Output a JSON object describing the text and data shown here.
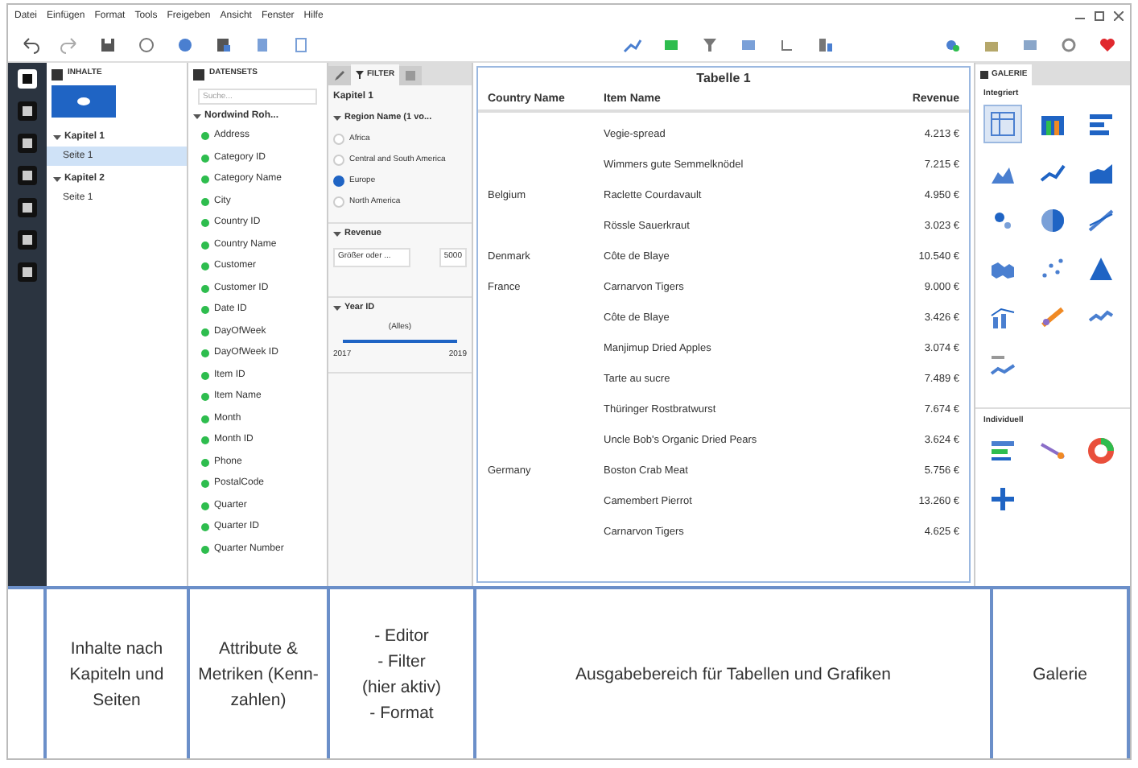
{
  "menu": [
    "Datei",
    "Einfügen",
    "Format",
    "Tools",
    "Freigeben",
    "Ansicht",
    "Fenster",
    "Hilfe"
  ],
  "contents": {
    "title": "INHALTE",
    "chapters": [
      {
        "label": "Kapitel 1",
        "expanded": true,
        "pages": [
          {
            "label": "Seite 1",
            "selected": true
          }
        ]
      },
      {
        "label": "Kapitel 2",
        "expanded": true,
        "pages": [
          {
            "label": "Seite 1",
            "selected": false
          }
        ]
      }
    ]
  },
  "datasets": {
    "title": "DATENSETS",
    "search": {
      "placeholder": "Suche..."
    },
    "dataset": "Nordwind Roh...",
    "items": [
      "Address",
      "Category ID",
      "Category Name",
      "City",
      "Country ID",
      "Country Name",
      "Customer",
      "Customer ID",
      "Date ID",
      "DayOfWeek",
      "DayOfWeek ID",
      "Item ID",
      "Item Name",
      "Month",
      "Month ID",
      "Phone",
      "PostalCode",
      "Quarter",
      "Quarter ID",
      "Quarter Number"
    ]
  },
  "filter": {
    "tab": "FILTER",
    "chapter": "Kapitel 1",
    "filters": [
      {
        "kind": "options",
        "title": "Region Name (1 vo...",
        "options": [
          {
            "label": "Africa",
            "selected": false
          },
          {
            "label": "Central and South America",
            "selected": false
          },
          {
            "label": "Europe",
            "selected": true
          },
          {
            "label": "North America",
            "selected": false
          }
        ]
      },
      {
        "kind": "metric",
        "title": "Revenue",
        "operator": "Größer oder ...",
        "value": "5000"
      },
      {
        "kind": "range",
        "title": "Year ID",
        "caption": "(Alles)",
        "level": 1,
        "min": "2017",
        "max": "2019"
      }
    ]
  },
  "table": {
    "title": "Tabelle 1",
    "columns": [
      "Country Name",
      "Item Name",
      "Revenue"
    ],
    "rows": [
      [
        "",
        "Vegie-spread",
        "4.213 €"
      ],
      [
        "",
        "Wimmers gute Semmelknödel",
        "7.215 €"
      ],
      [
        "Belgium",
        "Raclette Courdavault",
        "4.950 €"
      ],
      [
        "",
        "Rössle Sauerkraut",
        "3.023 €"
      ],
      [
        "Denmark",
        "Côte de Blaye",
        "10.540 €"
      ],
      [
        "France",
        "Carnarvon Tigers",
        "9.000 €"
      ],
      [
        "",
        "Côte de Blaye",
        "3.426 €"
      ],
      [
        "",
        "Manjimup Dried Apples",
        "3.074 €"
      ],
      [
        "",
        "Tarte au sucre",
        "7.489 €"
      ],
      [
        "",
        "Thüringer Rostbratwurst",
        "7.674 €"
      ],
      [
        "",
        "Uncle Bob's Organic Dried Pears",
        "3.624 €"
      ],
      [
        "Germany",
        "Boston Crab Meat",
        "5.756 €"
      ],
      [
        "",
        "Camembert Pierrot",
        "13.260 €"
      ],
      [
        "",
        "Carnarvon Tigers",
        "4.625 €"
      ]
    ]
  },
  "gallery": {
    "title": "GALERIE",
    "sections": [
      "Integriert",
      "Individuell"
    ]
  },
  "annotations": [
    "Inhalte nach Kapiteln und Seiten",
    "Attribute & Metriken (Kenn-zahlen)",
    "- Editor\n- Filter\n(hier aktiv)\n- Format",
    "Ausgabebereich für Tabellen und Grafiken",
    "Galerie"
  ]
}
